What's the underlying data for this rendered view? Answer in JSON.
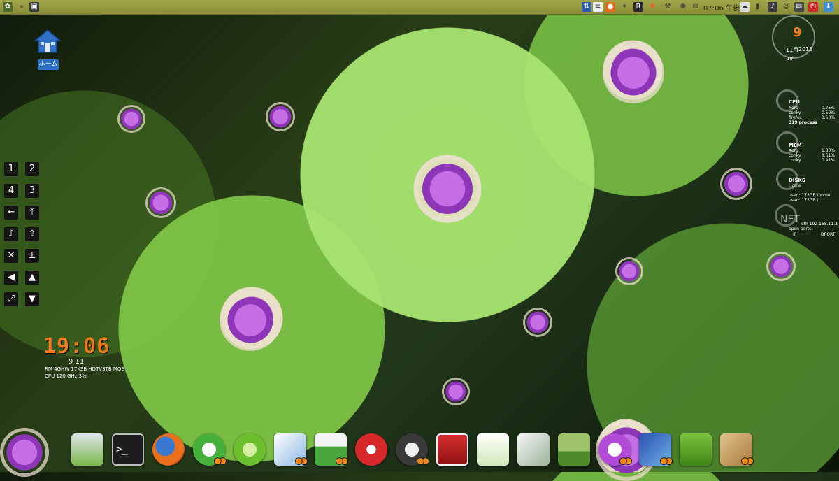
{
  "topbar": {
    "time": "07:06 午後"
  },
  "desktop": {
    "home_label": "ホーム"
  },
  "left_panel": {
    "workspace_1": "1",
    "workspace_2": "2",
    "workspace_3": "3",
    "workspace_4": "4"
  },
  "left_clock": {
    "time": "19:06",
    "date": "9 11",
    "info": "RM 4GHW 17KSB HDTV3TB MOB",
    "cpu": "CPU 120 GHz 3%"
  },
  "conky": {
    "day": "9",
    "month": "11月",
    "year": "2013",
    "small": "19",
    "cpu_title": "CPU",
    "cpu_rows": [
      {
        "name": "Xorg",
        "value": "0.75%"
      },
      {
        "name": "conky",
        "value": "0.50%"
      },
      {
        "name": "firefox",
        "value": "0.50%"
      }
    ],
    "cpu_procs": "319 process",
    "mem_title": "MEM",
    "mem_rows": [
      {
        "name": "Xorg",
        "value": "1.80%"
      },
      {
        "name": "conky",
        "value": "0.61%"
      },
      {
        "name": "conky",
        "value": "0.41%"
      }
    ],
    "disks_title": "DISKS",
    "disk_home": "Home",
    "disk_used_home": "used: 173GB /home",
    "disk_used_root": "used: 173GB /",
    "net_title": "NET",
    "net_ip": "eth 192.168.11.3",
    "open_ports": "open ports:",
    "ip_label": "IP",
    "dport_label": "DPORT"
  },
  "colors": {
    "accent_orange": "#f07a17",
    "topbar": "#a2a64a"
  },
  "dock_items": [
    "desktop-app-icon",
    "terminal-icon",
    "firefox-icon",
    "browser-icon",
    "settings-icon",
    "photo-icon",
    "scanner-icon",
    "media-icon",
    "camera-icon",
    "editor-icon",
    "shopping-icon",
    "screenshot-icon",
    "landscape-icon",
    "audio-icon",
    "paint-icon",
    "folder-icon",
    "package-icon"
  ]
}
